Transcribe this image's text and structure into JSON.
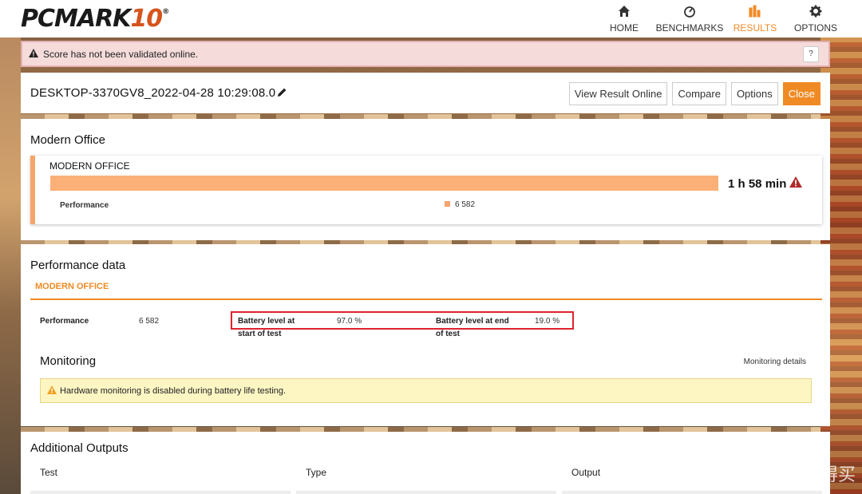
{
  "app": {
    "logo_text": "PCMARK",
    "logo_number": "10",
    "logo_reg": "®"
  },
  "nav": [
    {
      "label": "HOME",
      "icon": "home-icon"
    },
    {
      "label": "BENCHMARKS",
      "icon": "gauge-icon"
    },
    {
      "label": "RESULTS",
      "icon": "bar-chart-icon",
      "active": true
    },
    {
      "label": "OPTIONS",
      "icon": "gear-icon"
    }
  ],
  "alert": {
    "text": "Score has not been validated online.",
    "help": "?"
  },
  "result": {
    "title": "DESKTOP-3370GV8_2022-04-28 10:29:08.0",
    "buttons": {
      "view_online": "View Result Online",
      "compare": "Compare",
      "options": "Options",
      "close": "Close"
    }
  },
  "modern_office": {
    "heading": "Modern Office",
    "card_title": "MODERN OFFICE",
    "battery_time": "1 h 58 min",
    "perf_label": "Performance",
    "perf_value": "6 582"
  },
  "performance_data": {
    "heading": "Performance data",
    "tab": "MODERN OFFICE",
    "perf_label": "Performance",
    "perf_value": "6 582",
    "battery_start_label_1": "Battery level at",
    "battery_start_label_2": "start of test",
    "battery_start_value": "97.0 %",
    "battery_end_label_1": "Battery level at end",
    "battery_end_label_2": "of test",
    "battery_end_value": "19.0 %"
  },
  "monitoring": {
    "heading": "Monitoring",
    "details_link": "Monitoring details",
    "warning": "Hardware monitoring is disabled during battery life testing."
  },
  "additional_outputs": {
    "heading": "Additional Outputs",
    "columns": [
      "Test",
      "Type",
      "Output"
    ]
  },
  "watermark": {
    "glyph": "值",
    "text": "什么值得买"
  },
  "colors": {
    "accent": "#f08a24",
    "bar": "#fbb077",
    "alert_bg": "#f6dbdb",
    "warn_bg": "#fdf6c3",
    "highlight_box": "#e0232e"
  }
}
